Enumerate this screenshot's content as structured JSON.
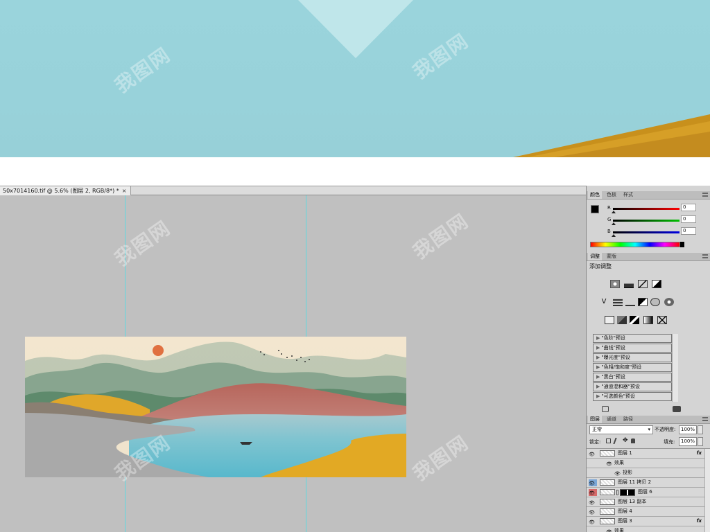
{
  "document_tab": {
    "title": "50x7014160.tif @ 5.6% (图层 2, RGB/8*) *",
    "close": "×"
  },
  "watermark": {
    "text": "我图网"
  },
  "color_panel": {
    "tabs": [
      "颜色",
      "色板",
      "样式"
    ],
    "channels": [
      {
        "label": "R",
        "value": "0",
        "color": "#d01010"
      },
      {
        "label": "G",
        "value": "0",
        "color": "#10a010"
      },
      {
        "label": "B",
        "value": "0",
        "color": "#1010c0"
      }
    ]
  },
  "adjust_panel": {
    "tabs": [
      "调整",
      "蒙版"
    ],
    "title": "添加调整",
    "presets": [
      "\"色阶\"预设",
      "\"曲线\"预设",
      "\"曝光度\"预设",
      "\"色相/饱和度\"预设",
      "\"黑白\"预设",
      "\"通道混和器\"预设",
      "\"可选颜色\"预设"
    ]
  },
  "layers_panel": {
    "tabs": [
      "图层",
      "通道",
      "路径"
    ],
    "blend_mode": "正常",
    "opacity_label": "不透明度:",
    "opacity_value": "100%",
    "lock_label": "锁定:",
    "fill_label": "填充:",
    "fill_value": "100%",
    "rows": [
      {
        "name": "图层 1",
        "fx": "fx",
        "indent": 0
      },
      {
        "name": "效果",
        "fx": "",
        "indent": 1
      },
      {
        "name": "投影",
        "fx": "",
        "indent": 2
      },
      {
        "name": "图层 11 拷贝 2",
        "fx": "",
        "indent": 0
      },
      {
        "name": "图层 6",
        "fx": "",
        "indent": 0
      },
      {
        "name": "图层 13 副本",
        "fx": "",
        "indent": 0
      },
      {
        "name": "图层 4",
        "fx": "",
        "indent": 0
      },
      {
        "name": "图层 3",
        "fx": "fx",
        "indent": 0
      },
      {
        "name": "效果",
        "fx": "",
        "indent": 1
      }
    ]
  }
}
